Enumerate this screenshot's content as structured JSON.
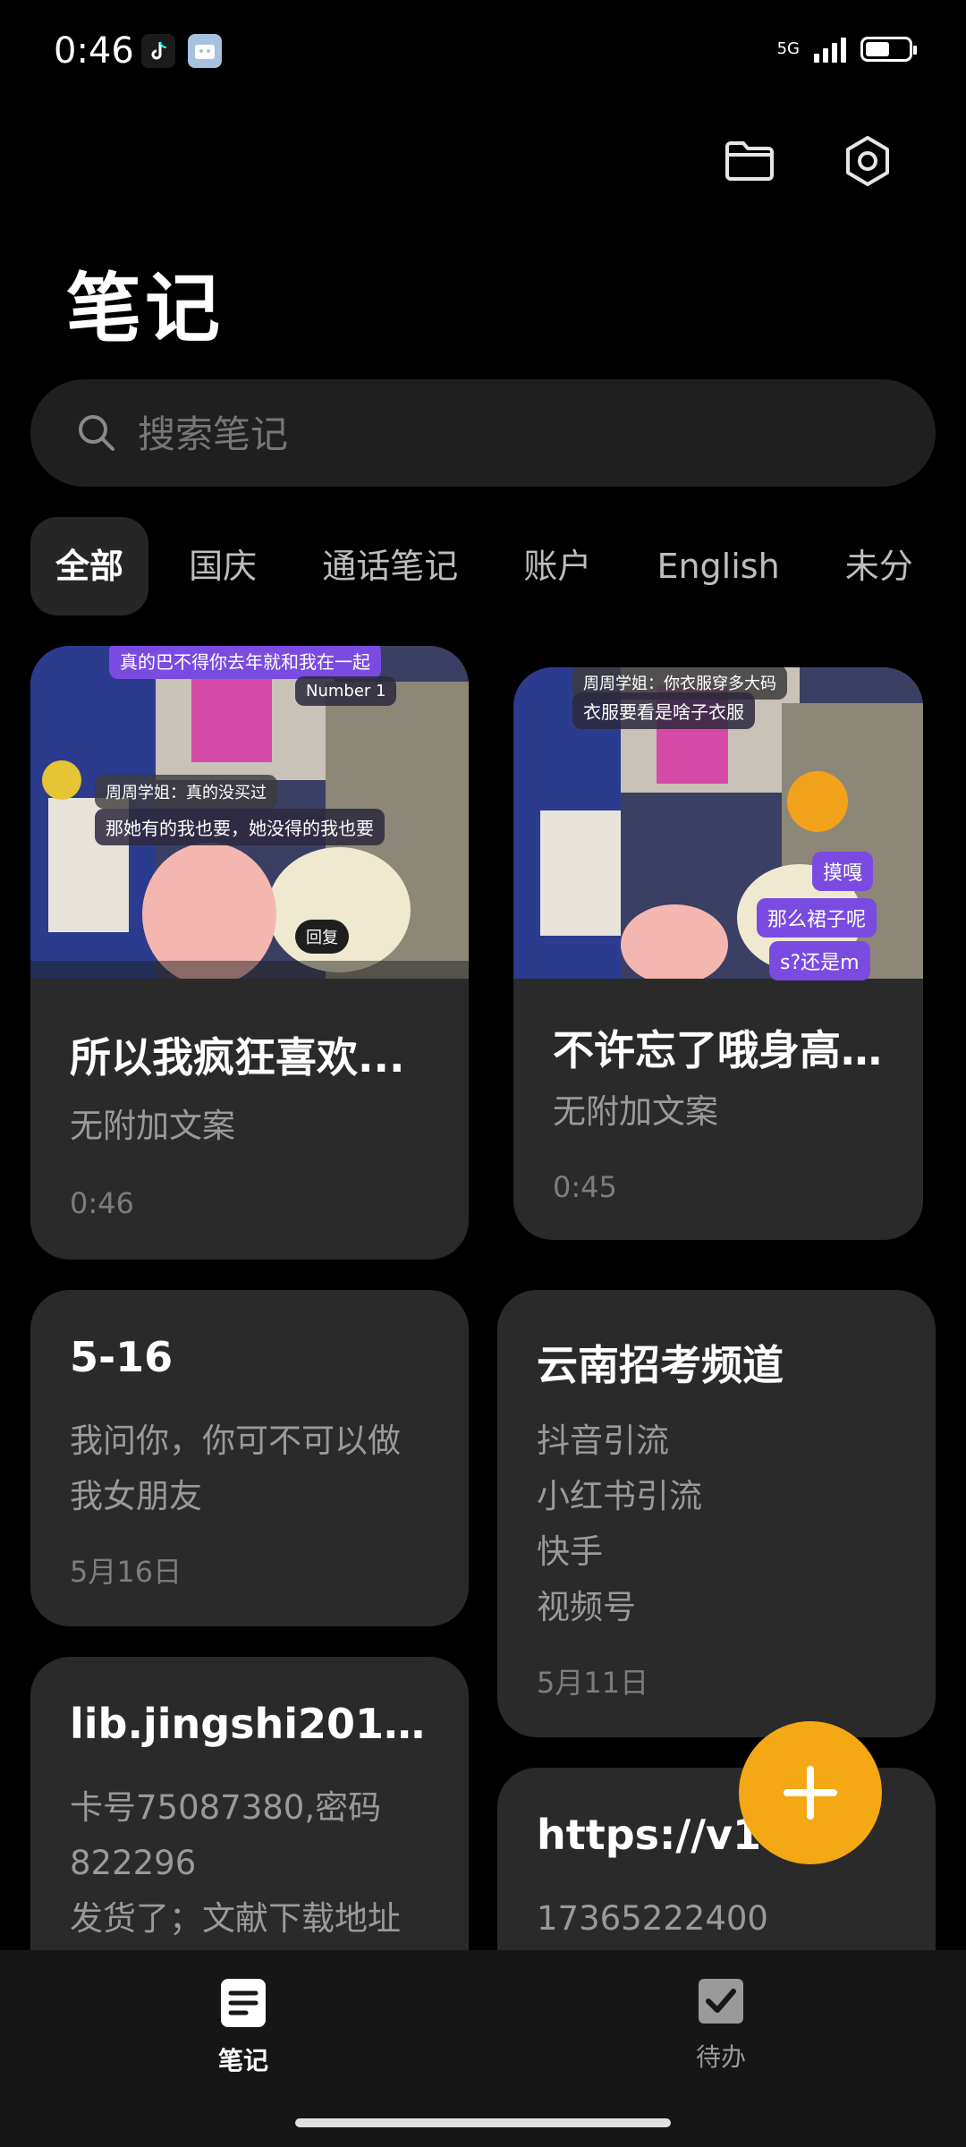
{
  "status_bar": {
    "time": "0:46",
    "network": "5G"
  },
  "header": {
    "title": "笔记"
  },
  "search": {
    "placeholder": "搜索笔记"
  },
  "tabs": [
    {
      "label": "全部",
      "active": true
    },
    {
      "label": "国庆"
    },
    {
      "label": "通话笔记"
    },
    {
      "label": "账户"
    },
    {
      "label": "English"
    },
    {
      "label": "未分"
    }
  ],
  "notes": [
    {
      "title": "所以我疯狂喜欢...",
      "body": [
        "无附加文案"
      ],
      "date": "0:46",
      "overlay": {
        "top_banner": "真的巴不得你去年就和我在一起",
        "tag": "Number 1",
        "nickname": "周周学姐：真的没买过",
        "comment": "那她有的我也要，她没得的我也要",
        "reply": "回复"
      }
    },
    {
      "title": "不许忘了哦身高1...",
      "body": [
        "无附加文案"
      ],
      "date": "0:45",
      "overlay": {
        "nickname": "周周学姐：你衣服穿多大码",
        "comment": "衣服要看是啥子衣服",
        "tags": [
          "摸嘎",
          "那么裙子呢",
          "s?还是m"
        ]
      }
    },
    {
      "title": "5-16",
      "body": [
        "我问你，你可不可以做",
        "我女朋友"
      ],
      "date": "5月16日"
    },
    {
      "title": "云南招考频道",
      "body": [
        "抖音引流",
        "小红书引流",
        "快手",
        "视频号"
      ],
      "date": "5月11日"
    },
    {
      "title": "lib.jingshi2015.c...",
      "body": [
        "卡号75087380,密码",
        "822296",
        "发货了；文献下载地址"
      ]
    },
    {
      "title": "https://v17",
      "body": [
        "17365222400"
      ]
    }
  ],
  "bottom_nav": {
    "notes_label": "笔记",
    "todo_label": "待办"
  },
  "colors": {
    "accent": "#f3a814",
    "card": "#2a2a2a",
    "background": "#000000"
  }
}
